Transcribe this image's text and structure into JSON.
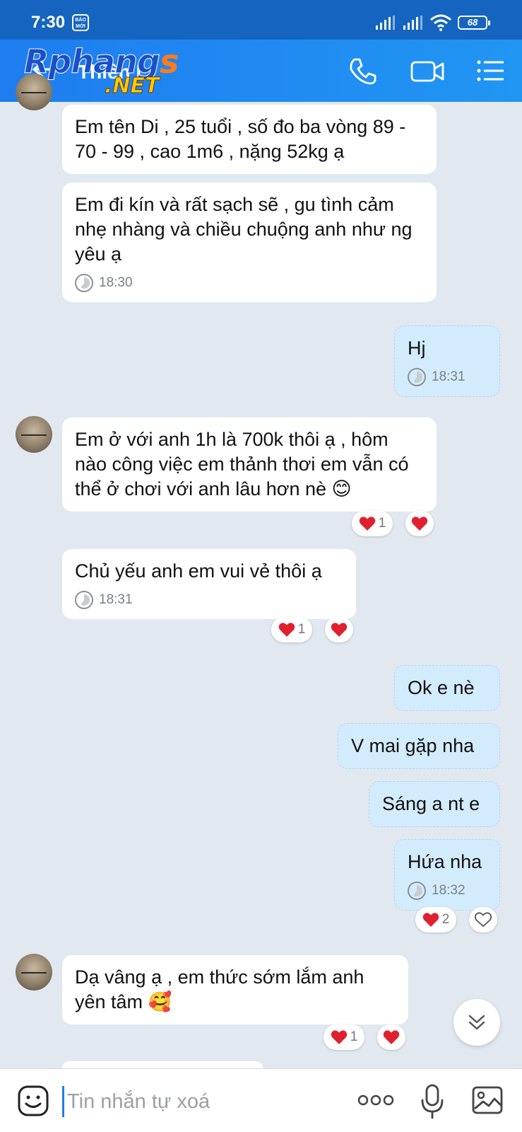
{
  "status_bar": {
    "time": "7:30",
    "news_badge": "BÁO MỚI",
    "battery": "68"
  },
  "header": {
    "contact_name": "Thiên L",
    "watermark": "Rphangs.NET",
    "watermark_part1": "Rphang",
    "watermark_part2": "s",
    "watermark_part3": ".NET"
  },
  "messages": [
    {
      "side": "in",
      "text": "Em tên Di , 25 tuổi , số đo ba vòng 89 - 70 - 99 , cao 1m6 , nặng 52kg ạ"
    },
    {
      "side": "in",
      "text": "Em đi kín và rất sạch sẽ , gu tình cảm nhẹ nhàng và chiều chuộng anh như ng yêu ạ",
      "time": "18:30"
    },
    {
      "side": "out",
      "text": "Hj",
      "time": "18:31"
    },
    {
      "side": "in",
      "text": " Em ở với anh 1h là 700k thôi ạ , hôm nào công việc em thảnh thơi em vẫn có thể ở chơi với anh lâu hơn nè 😊",
      "reaction_count": "1"
    },
    {
      "side": "in",
      "text": "Chủ yếu anh em vui vẻ thôi ạ",
      "time": "18:31",
      "reaction_count": "1"
    },
    {
      "side": "out",
      "text": "Ok e nè"
    },
    {
      "side": "out",
      "text": "V mai gặp nha"
    },
    {
      "side": "out",
      "text": "Sáng a nt e"
    },
    {
      "side": "out",
      "text": "Hứa nha",
      "time": "18:32",
      "reaction_count": "2"
    },
    {
      "side": "in",
      "text": "Dạ vâng ạ , em thức sớm lắm anh yên tâm 🥰",
      "reaction_count": "1"
    }
  ],
  "input": {
    "placeholder": "Tin nhắn tự xoá"
  },
  "colors": {
    "header": "#1e7df0",
    "background": "#e2e8f0",
    "incoming_bubble": "#ffffff",
    "outgoing_bubble": "#d3ecfd",
    "heart": "#e0202e"
  }
}
